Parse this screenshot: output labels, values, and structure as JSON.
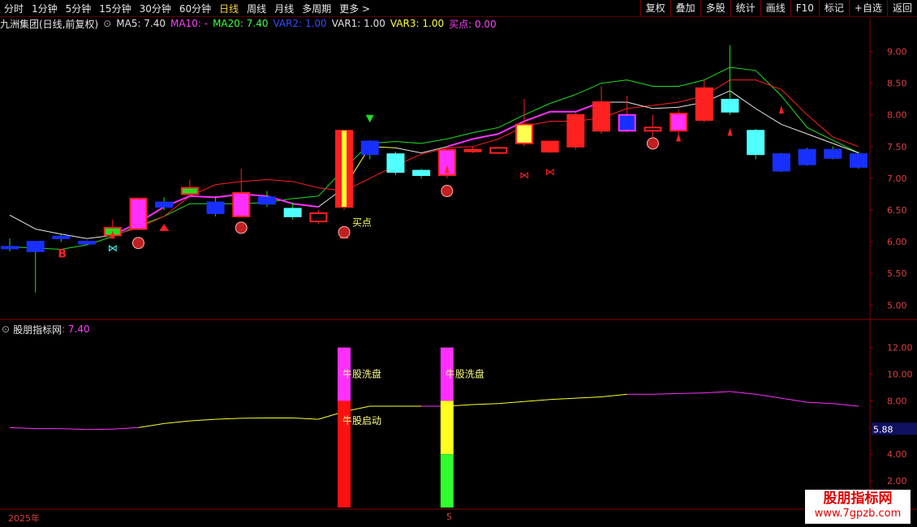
{
  "toolbar": {
    "periods": [
      "分时",
      "1分钟",
      "5分钟",
      "15分钟",
      "30分钟",
      "60分钟",
      "日线",
      "周线",
      "月线",
      "多周期",
      "更多 >"
    ],
    "active_period": "日线",
    "right_buttons": [
      "复权",
      "叠加",
      "多股",
      "统计",
      "画线",
      "F10",
      "标记",
      "+自选",
      "返回"
    ]
  },
  "main_legend": {
    "title": "九洲集团(日线,前复权)",
    "ma5": "MA5: 7.40",
    "ma10": "MA10: -",
    "ma20": "MA20: 7.40",
    "var2": "VAR2: 1.00",
    "var1": "VAR1: 1.00",
    "var3": "VAR3: 1.00",
    "buy_point": "买点: 0.00"
  },
  "main_axis_ticks": [
    "9.00",
    "8.50",
    "8.00",
    "7.50",
    "7.00",
    "6.50",
    "6.00",
    "5.50",
    "5.00"
  ],
  "sub_legend": {
    "title": "股朋指标网",
    "value": ": 7.40"
  },
  "sub_axis_ticks": [
    "12.00",
    "10.00",
    "8.00",
    "6.00",
    "4.00",
    "2.00"
  ],
  "sub_current_value": "5.88",
  "annotations": {
    "buy_label": "买点",
    "b_marker": "B",
    "washout_label_1": "牛股洗盘",
    "start_label": "牛股启动",
    "washout_label_2": "牛股洗盘"
  },
  "date_labels": {
    "year": "2025年",
    "month": "5"
  },
  "watermark": {
    "title": "股朋指标网",
    "url": "www.7gpzb.com"
  },
  "colors": {
    "up": "#ff2020",
    "down": "#2020ff",
    "ma5": "#ffffff",
    "ma10": "#ff2020",
    "ma20": "#20e020",
    "magenta": "#ff30ff",
    "yellow": "#ffff30",
    "cyan": "#40ffff",
    "axis": "#8b0000"
  },
  "chart_data": {
    "type": "candlestick",
    "y_range": [
      4.8,
      9.3
    ],
    "candles": [
      {
        "o": 5.9,
        "c": 5.92,
        "h": 6.05,
        "l": 5.85,
        "body": "blue"
      },
      {
        "o": 6.0,
        "c": 5.85,
        "h": 6.0,
        "l": 5.2,
        "body": "blue"
      },
      {
        "o": 6.06,
        "c": 6.08,
        "h": 6.12,
        "l": 6.0,
        "body": "blue"
      },
      {
        "o": 6.0,
        "c": 5.97,
        "h": 6.02,
        "l": 5.95,
        "body": "blue"
      },
      {
        "o": 6.1,
        "c": 6.22,
        "h": 6.35,
        "l": 6.05,
        "body": "green"
      },
      {
        "o": 6.2,
        "c": 6.68,
        "h": 6.7,
        "l": 6.18,
        "body": "magenta"
      },
      {
        "o": 6.62,
        "c": 6.55,
        "h": 6.7,
        "l": 6.5,
        "body": "blue"
      },
      {
        "o": 6.75,
        "c": 6.85,
        "h": 6.98,
        "l": 6.72,
        "body": "green"
      },
      {
        "o": 6.62,
        "c": 6.45,
        "h": 6.72,
        "l": 6.4,
        "body": "blue"
      },
      {
        "o": 6.4,
        "c": 6.77,
        "h": 7.15,
        "l": 6.4,
        "body": "magenta"
      },
      {
        "o": 6.7,
        "c": 6.6,
        "h": 6.8,
        "l": 6.55,
        "body": "blue"
      },
      {
        "o": 6.52,
        "c": 6.4,
        "h": 6.62,
        "l": 6.35,
        "body": "cyan"
      },
      {
        "o": 6.45,
        "c": 6.32,
        "h": 6.5,
        "l": 6.28,
        "body": "redhollow"
      },
      {
        "o": 6.55,
        "c": 7.75,
        "h": 7.75,
        "l": 6.5,
        "body": "yellowred"
      },
      {
        "o": 7.58,
        "c": 7.38,
        "h": 7.6,
        "l": 7.3,
        "body": "blue"
      },
      {
        "o": 7.38,
        "c": 7.1,
        "h": 7.42,
        "l": 7.05,
        "body": "cyan"
      },
      {
        "o": 7.12,
        "c": 7.05,
        "h": 7.15,
        "l": 7.0,
        "body": "cyan"
      },
      {
        "o": 7.05,
        "c": 7.45,
        "h": 7.45,
        "l": 7.0,
        "body": "magenta"
      },
      {
        "o": 7.45,
        "c": 7.45,
        "h": 7.5,
        "l": 7.4,
        "body": "doji"
      },
      {
        "o": 7.4,
        "c": 7.48,
        "h": 7.48,
        "l": 7.38,
        "body": "redhollow"
      },
      {
        "o": 7.55,
        "c": 7.85,
        "h": 8.25,
        "l": 7.5,
        "body": "yellow"
      },
      {
        "o": 7.42,
        "c": 7.58,
        "h": 7.58,
        "l": 7.4,
        "body": "red"
      },
      {
        "o": 7.5,
        "c": 8.0,
        "h": 8.05,
        "l": 7.45,
        "body": "red"
      },
      {
        "o": 7.75,
        "c": 8.2,
        "h": 8.45,
        "l": 7.7,
        "body": "red"
      },
      {
        "o": 7.75,
        "c": 8.0,
        "h": 8.3,
        "l": 7.72,
        "body": "bluemag"
      },
      {
        "o": 7.75,
        "c": 7.8,
        "h": 8.0,
        "l": 7.65,
        "body": "redhollow"
      },
      {
        "o": 7.75,
        "c": 8.02,
        "h": 8.08,
        "l": 7.7,
        "body": "magenta"
      },
      {
        "o": 7.92,
        "c": 8.42,
        "h": 8.55,
        "l": 7.88,
        "body": "red"
      },
      {
        "o": 8.05,
        "c": 8.24,
        "h": 9.1,
        "l": 8.0,
        "body": "cyan"
      },
      {
        "o": 7.75,
        "c": 7.38,
        "h": 7.78,
        "l": 7.3,
        "body": "cyan"
      },
      {
        "o": 7.38,
        "c": 7.12,
        "h": 7.4,
        "l": 7.1,
        "body": "blue"
      },
      {
        "o": 7.45,
        "c": 7.22,
        "h": 7.48,
        "l": 7.2,
        "body": "blue"
      },
      {
        "o": 7.45,
        "c": 7.32,
        "h": 7.5,
        "l": 7.3,
        "body": "blue"
      },
      {
        "o": 7.38,
        "c": 7.18,
        "h": 7.42,
        "l": 7.15,
        "body": "blue"
      }
    ],
    "ma5": [
      6.42,
      6.2,
      6.12,
      6.05,
      6.1,
      6.3,
      6.55,
      6.72,
      6.7,
      6.75,
      6.72,
      6.6,
      6.55,
      6.85,
      7.5,
      7.48,
      7.4,
      7.5,
      7.62,
      7.7,
      7.9,
      8.05,
      8.05,
      8.2,
      8.2,
      8.1,
      8.12,
      8.2,
      8.38,
      8.1,
      7.85,
      7.7,
      7.55,
      7.4
    ],
    "ma10": [
      null,
      null,
      null,
      null,
      6.1,
      6.22,
      6.4,
      6.72,
      6.9,
      6.95,
      6.98,
      6.95,
      6.85,
      6.8,
      7.0,
      7.2,
      7.38,
      7.48,
      7.5,
      7.62,
      7.82,
      7.9,
      7.9,
      7.95,
      8.1,
      8.15,
      8.2,
      8.3,
      8.55,
      8.55,
      8.4,
      8.0,
      7.65,
      7.5
    ],
    "ma20": [
      5.92,
      5.9,
      5.88,
      5.95,
      6.08,
      6.25,
      6.4,
      6.6,
      6.6,
      6.6,
      6.62,
      6.68,
      6.72,
      7.15,
      7.55,
      7.58,
      7.55,
      7.62,
      7.72,
      7.8,
      8.0,
      8.18,
      8.32,
      8.5,
      8.55,
      8.45,
      8.45,
      8.55,
      8.75,
      8.7,
      8.3,
      7.8,
      7.6,
      7.4
    ],
    "sub_indicator": [
      6.0,
      5.92,
      5.92,
      5.85,
      5.88,
      6.0,
      6.3,
      6.5,
      6.62,
      6.7,
      6.72,
      6.72,
      6.62,
      7.2,
      7.6,
      7.6,
      7.6,
      7.6,
      7.72,
      7.8,
      7.95,
      8.1,
      8.2,
      8.3,
      8.5,
      8.5,
      8.55,
      8.6,
      8.7,
      8.5,
      8.2,
      7.9,
      7.8,
      7.6
    ],
    "sub_range": [
      0,
      13.5
    ]
  }
}
